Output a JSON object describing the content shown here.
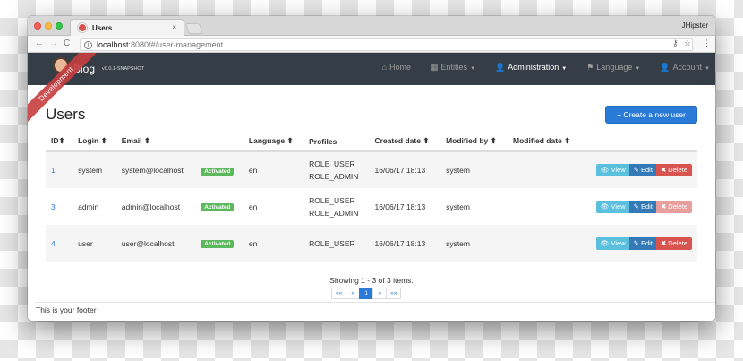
{
  "browser": {
    "tab_title": "Users",
    "tab_close": "×",
    "profile_name": "JHipster",
    "url_host": "localhost",
    "url_rest": ":8080/#/user-management",
    "nav": {
      "back": "←",
      "forward": "→",
      "reload": "C"
    },
    "omni_icons": {
      "key": "⚷",
      "star": "☆",
      "menu": "⋮"
    }
  },
  "navbar": {
    "brand": "Blog",
    "version": "v0.0.1-SNAPSHOT",
    "links": [
      {
        "icon": "⌂",
        "label": "Home",
        "caret": ""
      },
      {
        "icon": "▦",
        "label": "Entities",
        "caret": "▼"
      },
      {
        "icon": "👤",
        "label": "Administration",
        "caret": "▼"
      },
      {
        "icon": "⚑",
        "label": "Language",
        "caret": "▼"
      },
      {
        "icon": "👤",
        "label": "Account",
        "caret": "▼"
      }
    ]
  },
  "ribbon": {
    "label": "Development"
  },
  "page": {
    "title": "Users",
    "create_button": "+ Create a new user"
  },
  "table": {
    "headers": [
      "ID",
      "Login",
      "Email",
      "",
      "Language",
      "Profiles",
      "Created date",
      "Modified by",
      "Modified date",
      ""
    ],
    "sort_icon": "⬍",
    "rows": [
      {
        "id": "1",
        "login": "system",
        "email": "system@localhost",
        "status": "Activated",
        "language": "en",
        "profiles": [
          "ROLE_USER",
          "ROLE_ADMIN"
        ],
        "created": "16/06/17 18:13",
        "modified_by": "system",
        "modified_date": ""
      },
      {
        "id": "3",
        "login": "admin",
        "email": "admin@localhost",
        "status": "Activated",
        "language": "en",
        "profiles": [
          "ROLE_USER",
          "ROLE_ADMIN"
        ],
        "created": "16/06/17 18:13",
        "modified_by": "system",
        "modified_date": ""
      },
      {
        "id": "4",
        "login": "user",
        "email": "user@localhost",
        "status": "Activated",
        "language": "en",
        "profiles": [
          "ROLE_USER"
        ],
        "created": "16/06/17 18:13",
        "modified_by": "system",
        "modified_date": ""
      }
    ],
    "actions": {
      "view": "👁 View",
      "edit": "✎ Edit",
      "delete": "✖ Delete"
    }
  },
  "pagination": {
    "info": "Showing 1 - 3 of 3 items.",
    "first": "««",
    "prev": "«",
    "current": "1",
    "next": "»",
    "last": "»»"
  },
  "footer": {
    "text": "This is your footer"
  }
}
